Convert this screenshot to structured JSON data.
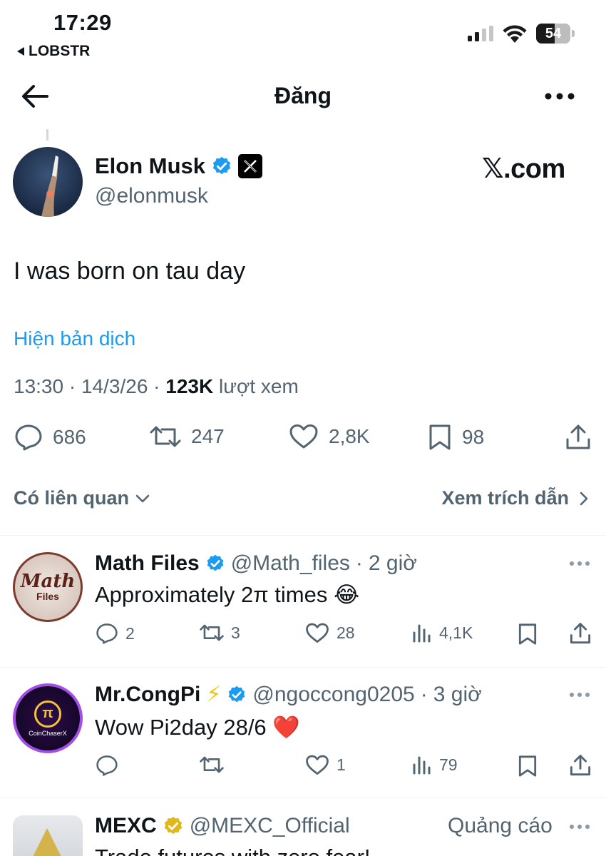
{
  "status_bar": {
    "time": "17:29",
    "back_app": "LOBSTR",
    "battery": "54"
  },
  "header": {
    "title": "Đăng"
  },
  "main_tweet": {
    "name": "Elon Musk",
    "handle": "@elonmusk",
    "brand": "𝕏.com",
    "text": "I was born on tau day",
    "translate_link": "Hiện bản dịch",
    "time": "13:30",
    "date": "14/3/26",
    "views": "123K",
    "views_label": "lượt xem",
    "replies": "686",
    "reposts": "247",
    "likes": "2,8K",
    "bookmarks": "98"
  },
  "sort": {
    "related_label": "Có liên quan",
    "quotes_label": "Xem trích dẫn"
  },
  "replies": [
    {
      "name": "Math Files",
      "handle": "@Math_files",
      "time": "2 giờ",
      "text": "Approximately 2π times 😂",
      "avatar_text": "Math",
      "avatar_subtext": "Files",
      "stats": {
        "replies": "2",
        "reposts": "3",
        "likes": "28",
        "views": "4,1K"
      }
    },
    {
      "name": "Mr.CongPi",
      "name_emoji": "⚡",
      "handle": "@ngoccong0205",
      "time": "3 giờ",
      "text": "Wow Pi2day 28/6 ❤️",
      "avatar_text": "π",
      "avatar_subtext": "CoinChaserX",
      "stats": {
        "replies": "",
        "reposts": "",
        "likes": "1",
        "views": "79"
      }
    },
    {
      "name": "MEXC",
      "handle": "@MEXC_Official",
      "ad_label": "Quảng cáo",
      "text": "Trade futures with zero fear!"
    }
  ],
  "colors": {
    "accent": "#1d9bf0",
    "secondary_text": "#536471",
    "verified": "#1d9bf0",
    "gold_verified": "#e2b719",
    "heart": "#e0245e"
  }
}
